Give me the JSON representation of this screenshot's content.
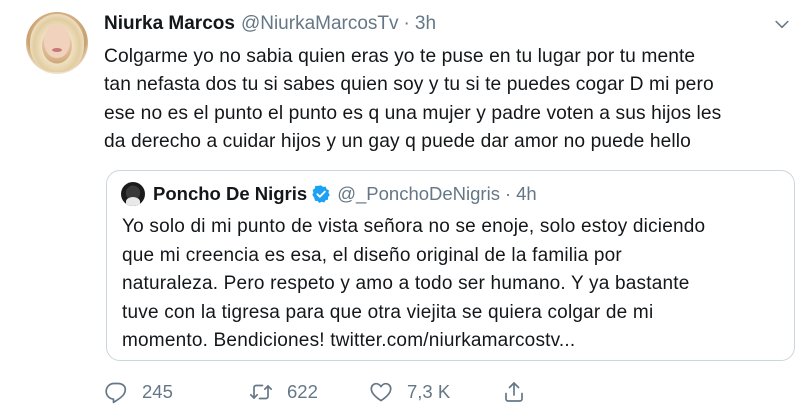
{
  "tweet": {
    "author_name": "Niurka Marcos",
    "author_handle": "@NiurkaMarcosTv",
    "separator": "·",
    "time": "3h",
    "text": "Colgarme yo no sabia quien eras yo te puse en tu lugar por tu mente\ntan nefasta dos tu si sabes quien soy y tu si te puedes cogar D mi pero\nese no es el punto el punto es q una mujer y padre voten a sus hijos les\nda derecho a cuidar hijos y un gay q puede dar amor no puede hello"
  },
  "quote": {
    "author_name": "Poncho De Nigris",
    "author_handle": "@_PonchoDeNigris",
    "separator": "·",
    "time": "4h",
    "verified": true,
    "text": "Yo solo di mi punto de vista señora no se enoje, solo estoy diciendo\nque mi creencia es esa, el diseño original de la familia por\nnaturaleza. Pero respeto y amo a todo ser humano. Y ya bastante\ntuve con la tigresa para que otra viejita se quiera colgar de mi\nmomento. Bendiciones! twitter.com/niurkamarcostv..."
  },
  "actions": {
    "reply_count": "245",
    "retweet_count": "622",
    "like_count": "7,3 K"
  },
  "icons": {
    "more": "chevron-down-icon",
    "verified": "verified-badge-icon",
    "reply": "reply-icon",
    "retweet": "retweet-icon",
    "like": "heart-icon",
    "share": "share-icon"
  },
  "colors": {
    "text": "#14171a",
    "secondary": "#657786",
    "verified": "#1da1f2",
    "border": "#ccd6dd"
  }
}
